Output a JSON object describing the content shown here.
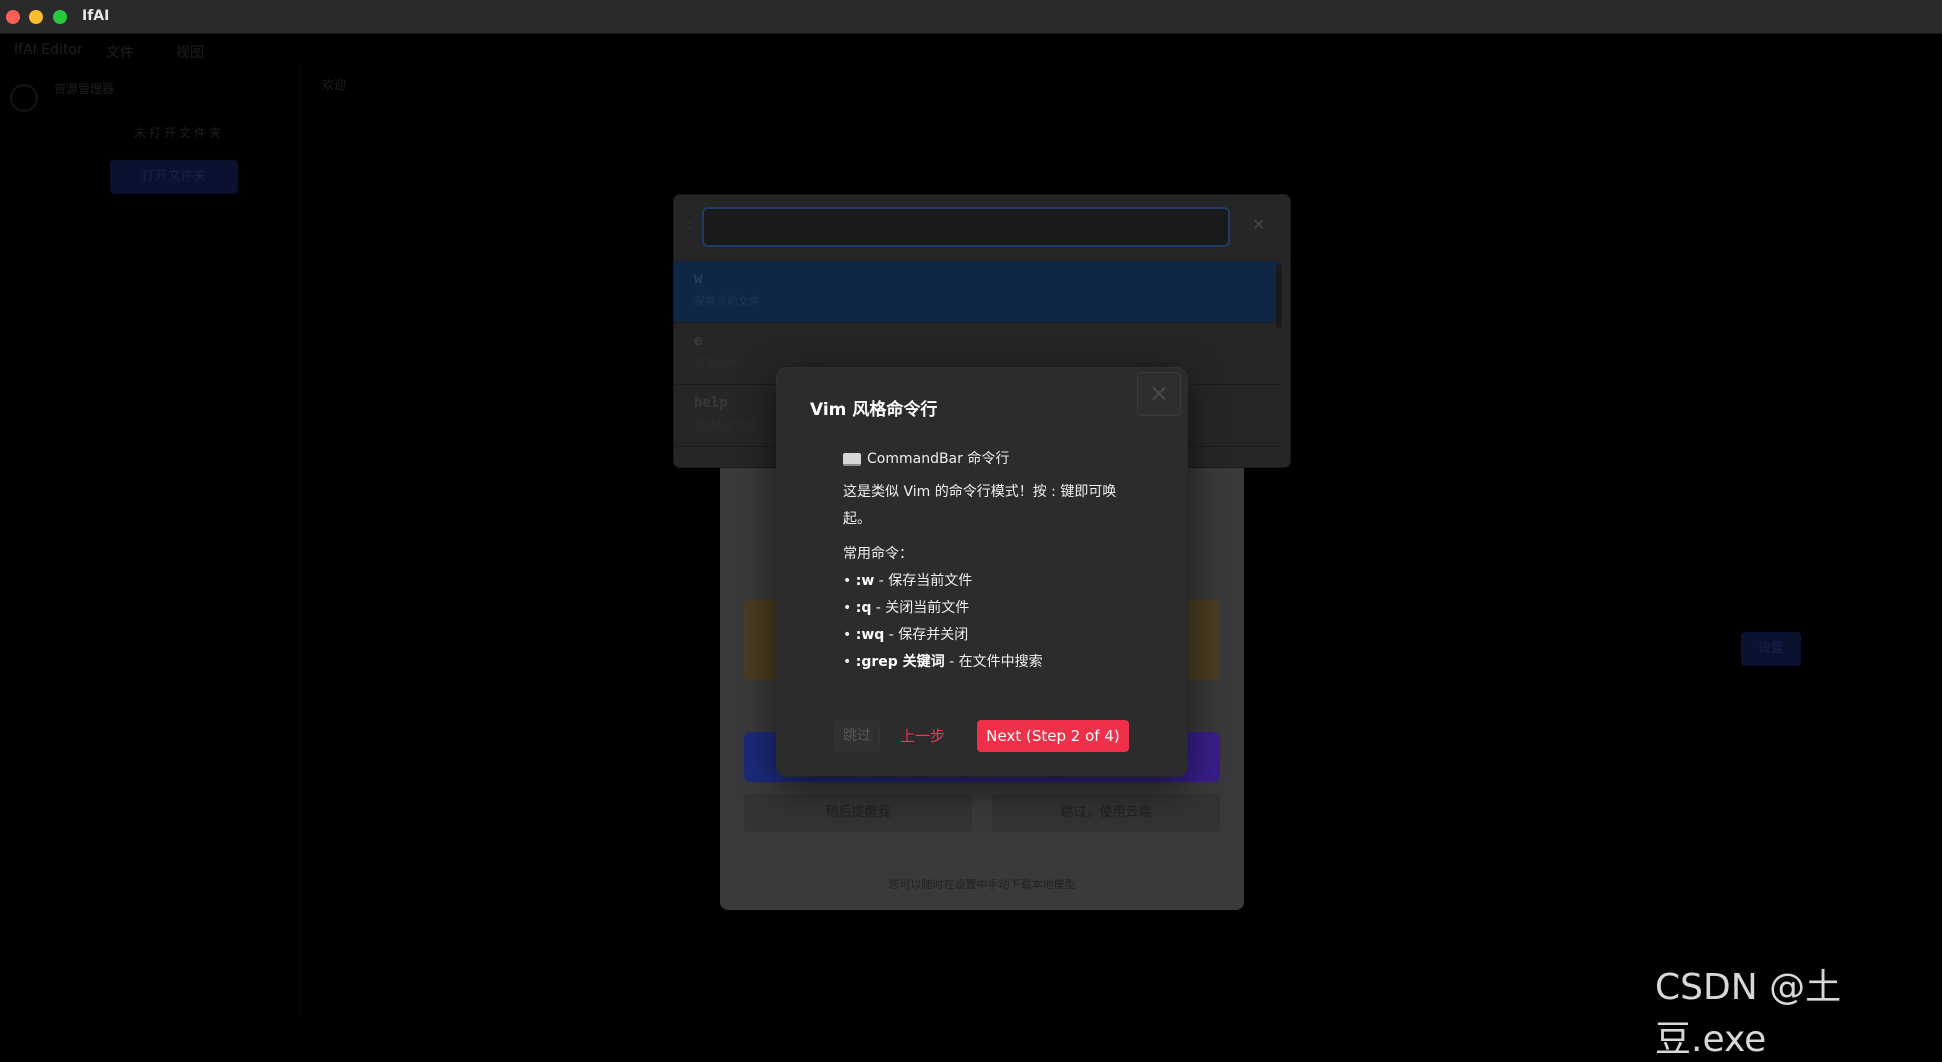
{
  "window": {
    "title": "IfAI"
  },
  "menubar": {
    "items": [
      "IfAI Editor",
      "文件",
      "视图"
    ]
  },
  "sidebar": {
    "header": "资源管理器",
    "empty_text": "未打开文件夹",
    "open_button": "打开文件夹"
  },
  "editor": {
    "tab_label": "欢迎"
  },
  "right_panel": {
    "button_label": "设置"
  },
  "onboarding": {
    "secondary_left": "稍后提醒我",
    "secondary_right": "跳过，使用云端",
    "note": "您可以随时在设置中手动下载本地模型"
  },
  "command_bar": {
    "input_value": "",
    "items": [
      {
        "name": "w",
        "desc": "保存当前文件"
      },
      {
        "name": "e",
        "desc": "编辑文件"
      },
      {
        "name": "help",
        "desc": "显示帮助信息"
      }
    ]
  },
  "tour": {
    "title": "Vim 风格命令行",
    "heading": "CommandBar 命令行",
    "intro": "这是类似 Vim 的命令行模式！按 : 键即可唤起。",
    "commands_label": "常用命令：",
    "commands": [
      {
        "cmd": ":w",
        "desc": " - 保存当前文件"
      },
      {
        "cmd": ":q",
        "desc": " - 关闭当前文件"
      },
      {
        "cmd": ":wq",
        "desc": " - 保存并关闭"
      },
      {
        "cmd": ":grep 关键词",
        "desc": " - 在文件中搜索"
      }
    ],
    "skip_label": "跳过",
    "back_label": "上一步",
    "next_label": "Next (Step 2 of 4)"
  },
  "watermark": "CSDN @土豆.exe"
}
